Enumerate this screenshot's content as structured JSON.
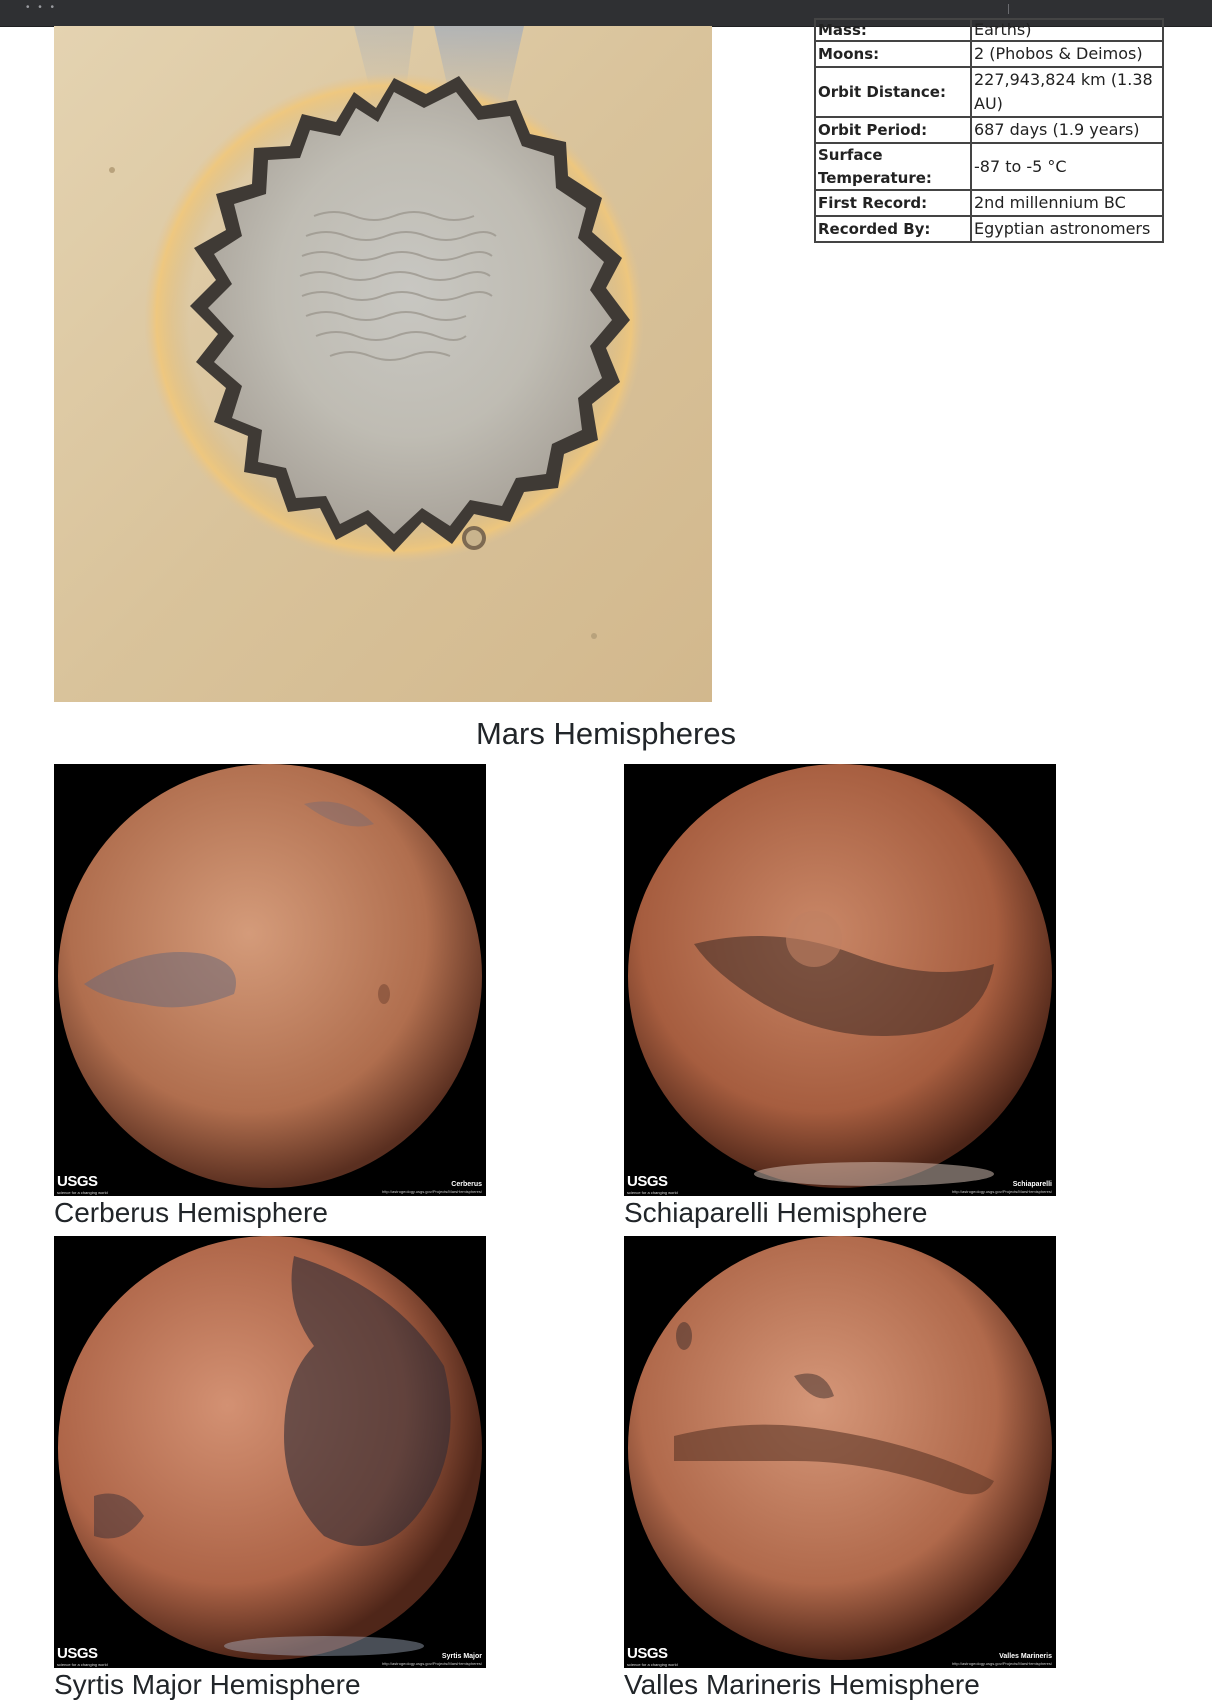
{
  "facts": {
    "rows": [
      {
        "label": "Mass:",
        "value": "Earths)"
      },
      {
        "label": "Moons:",
        "value": "2 (Phobos & Deimos)"
      },
      {
        "label": "Orbit Distance:",
        "value": "227,943,824 km (1.38 AU)"
      },
      {
        "label": "Orbit Period:",
        "value": "687 days (1.9 years)"
      },
      {
        "label": "Surface Temperature:",
        "value": "-87 to -5 °C"
      },
      {
        "label": "First Record:",
        "value": "2nd millennium BC"
      },
      {
        "label": "Recorded By:",
        "value": "Egyptian astronomers"
      }
    ]
  },
  "hemispheres": {
    "title": "Mars Hemispheres",
    "items": [
      {
        "name": "Cerberus Hemisphere",
        "caption": "Cerberus",
        "logo": "USGS",
        "logo_sub": "science for a changing world",
        "url": "http://astrogeology.usgs.gov/Projects/MarsHemispheres/"
      },
      {
        "name": "Schiaparelli Hemisphere",
        "caption": "Schiaparelli",
        "logo": "USGS",
        "logo_sub": "science for a changing world",
        "url": "http://astrogeology.usgs.gov/Projects/MarsHemispheres/"
      },
      {
        "name": "Syrtis Major Hemisphere",
        "caption": "Syrtis Major",
        "logo": "USGS",
        "logo_sub": "science for a changing world",
        "url": "http://astrogeology.usgs.gov/Projects/MarsHemispheres/"
      },
      {
        "name": "Valles Marineris Hemisphere",
        "caption": "Valles Marineris",
        "logo": "USGS",
        "logo_sub": "science for a changing world",
        "url": "http://astrogeology.usgs.gov/Projects/MarsHemispheres/"
      }
    ]
  }
}
